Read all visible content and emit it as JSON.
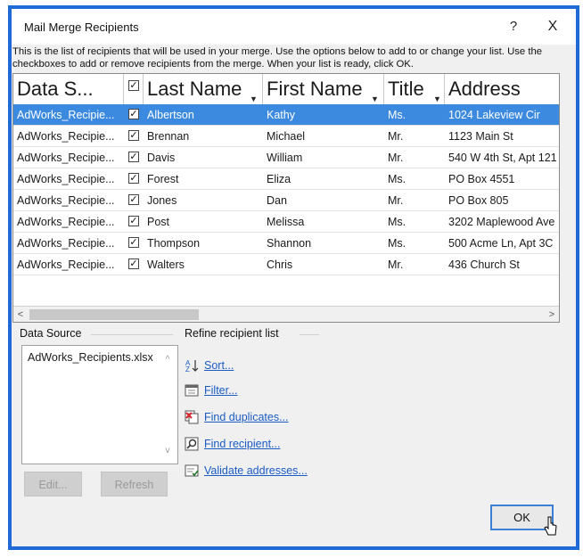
{
  "dialog": {
    "title": "Mail Merge Recipients",
    "help_label": "?",
    "close_label": "X",
    "description": "This is the list of recipients that will be used in your merge.  Use the options below to add to or change your list.  Use the checkboxes to add or remove recipients from the merge.  When your list is ready, click OK."
  },
  "table": {
    "columns": [
      "Data S...",
      "✓",
      "Last Name",
      "First Name",
      "Title",
      "Address"
    ],
    "rows": [
      {
        "source": "AdWorks_Recipie...",
        "checked": "✓",
        "last": "Albertson",
        "first": "Kathy",
        "title": "Ms.",
        "address": "1024 Lakeview Cir",
        "selected": true
      },
      {
        "source": "AdWorks_Recipie...",
        "checked": "✓",
        "last": "Brennan",
        "first": "Michael",
        "title": "Mr.",
        "address": "1123 Main St",
        "selected": false
      },
      {
        "source": "AdWorks_Recipie...",
        "checked": "✓",
        "last": "Davis",
        "first": "William",
        "title": "Mr.",
        "address": "540 W 4th St, Apt 121",
        "selected": false
      },
      {
        "source": "AdWorks_Recipie...",
        "checked": "✓",
        "last": "Forest",
        "first": "Eliza",
        "title": "Ms.",
        "address": "PO Box 4551",
        "selected": false
      },
      {
        "source": "AdWorks_Recipie...",
        "checked": "✓",
        "last": "Jones",
        "first": "Dan",
        "title": "Mr.",
        "address": "PO Box 805",
        "selected": false
      },
      {
        "source": "AdWorks_Recipie...",
        "checked": "✓",
        "last": "Post",
        "first": "Melissa",
        "title": "Ms.",
        "address": "3202 Maplewood Ave",
        "selected": false
      },
      {
        "source": "AdWorks_Recipie...",
        "checked": "✓",
        "last": "Thompson",
        "first": "Shannon",
        "title": "Ms.",
        "address": "500 Acme Ln, Apt 3C",
        "selected": false
      },
      {
        "source": "AdWorks_Recipie...",
        "checked": "✓",
        "last": "Walters",
        "first": "Chris",
        "title": "Mr.",
        "address": "436 Church St",
        "selected": false
      }
    ],
    "selected_color": "#3c8ae0"
  },
  "data_source": {
    "label": "Data Source",
    "items": [
      "AdWorks_Recipients.xlsx"
    ],
    "edit_label": "Edit...",
    "refresh_label": "Refresh"
  },
  "refine": {
    "label": "Refine recipient list",
    "sort": "Sort...",
    "filter": "Filter...",
    "find_duplicates": "Find duplicates...",
    "find_recipient": "Find recipient...",
    "validate": "Validate addresses..."
  },
  "ok_label": "OK",
  "colors": {
    "accent": "#1f6ad6",
    "link": "#1a5bc4"
  }
}
